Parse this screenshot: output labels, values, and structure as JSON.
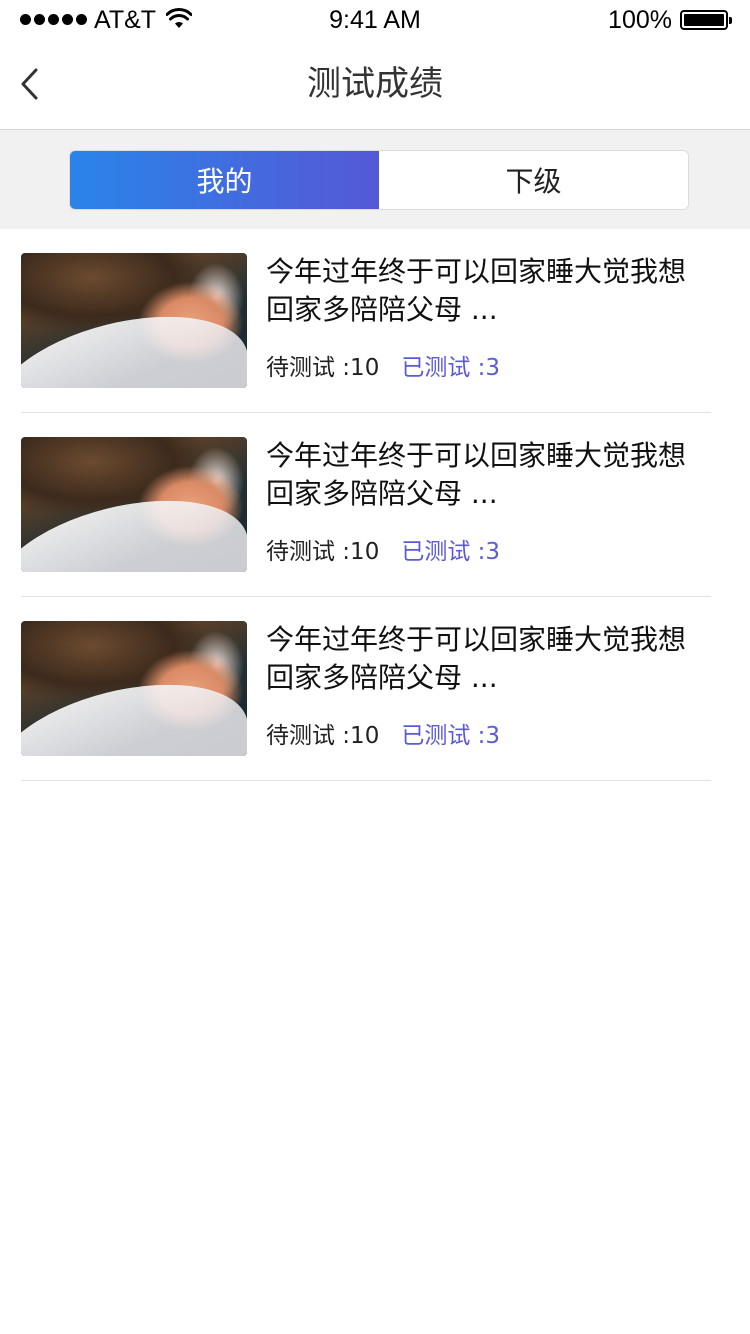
{
  "status_bar": {
    "carrier": "AT&T",
    "time": "9:41 AM",
    "battery": "100%",
    "icons": [
      "signal-dots-icon",
      "wifi-icon",
      "battery-icon"
    ]
  },
  "nav": {
    "title": "测试成绩",
    "back_icon": "chevron-left-icon"
  },
  "tabs": [
    {
      "label": "我的",
      "active": true
    },
    {
      "label": "下级",
      "active": false
    }
  ],
  "colors": {
    "tab_gradient_start": "#2a84ea",
    "tab_gradient_end": "#5558d6",
    "tested_text": "#5b5bd6"
  },
  "items": [
    {
      "title": "今年过年终于可以回家睡大觉我想回家多陪陪父母 ...",
      "pending": "待测试 :10",
      "tested": "已测试 :3"
    },
    {
      "title": "今年过年终于可以回家睡大觉我想回家多陪陪父母 ...",
      "pending": "待测试 :10",
      "tested": "已测试 :3"
    },
    {
      "title": "今年过年终于可以回家睡大觉我想回家多陪陪父母 ...",
      "pending": "待测试 :10",
      "tested": "已测试 :3"
    }
  ]
}
